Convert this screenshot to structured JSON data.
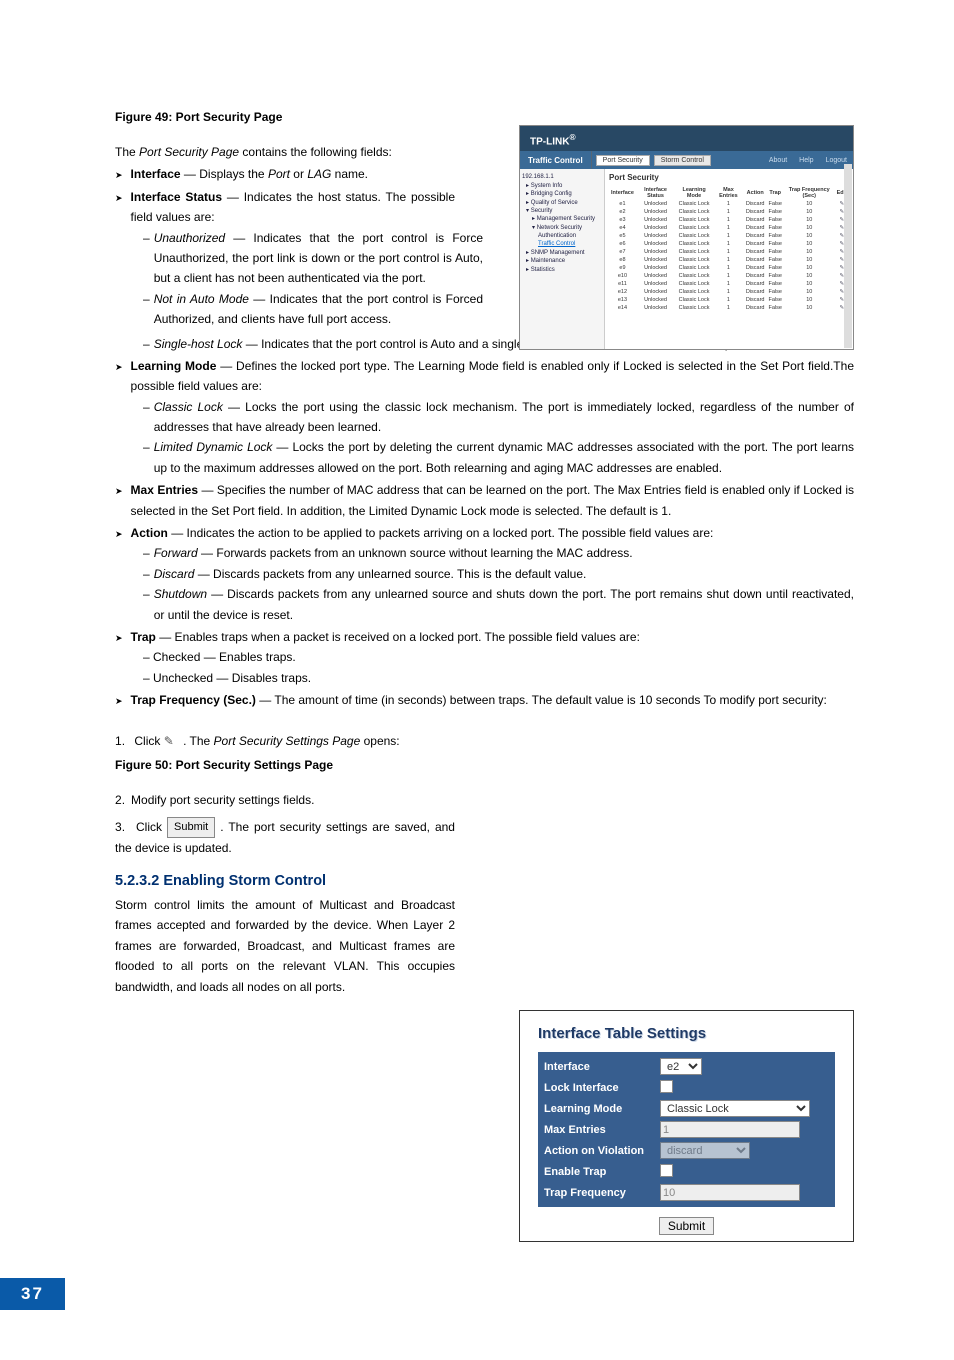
{
  "page_number": "37",
  "fig49_caption": "Figure 49: Port Security Page",
  "intro": "The Port Security Page contains the following fields:",
  "interface_label": "Interface",
  "interface_desc": " — Displays the Port or LAG name.",
  "interface_status_label": "Interface Status",
  "interface_status_desc": " — Indicates the host status. The possible field values are:",
  "unauthorized_label": "Unauthorized",
  "unauthorized_desc": " — Indicates that the port control is Force Unauthorized, the port link is down or the port control is Auto, but a client has not been authenticated via the port.",
  "notauto_label": "Not in Auto Mode",
  "notauto_desc": " — Indicates that the port control is Forced Authorized, and clients have full port access.",
  "singlehost_label": "Single-host Lock",
  "singlehost_desc": " — Indicates that the port control is Auto and a single client has been authenticated via the port.",
  "learning_label": "Learning Mode",
  "learning_desc": " — Defines the locked port type. The Learning Mode field is enabled only if Locked is selected in the Set Port field.The possible field values are:",
  "classic_label": "Classic Lock",
  "classic_desc": " — Locks the port using the classic lock mechanism. The port is immediately locked, regardless of the number of addresses that have already been learned.",
  "limited_label": "Limited Dynamic Lock",
  "limited_desc": " — Locks the port by deleting the current dynamic MAC addresses associated with the port. The port learns up to the maximum addresses allowed on the port. Both relearning and aging MAC addresses are enabled.",
  "maxentries_label": "Max Entries",
  "maxentries_desc": " — Specifies the number of MAC address that can be learned on the port. The Max Entries field is enabled only if Locked is selected in the Set Port field. In addition, the Limited Dynamic Lock mode is selected. The default is 1.",
  "action_label": "Action",
  "action_desc": " — Indicates the action to be applied to packets arriving on a locked port. The possible field values are:",
  "forward_label": "Forward",
  "forward_desc": " — Forwards packets from an unknown source without learning the MAC address.",
  "discard_label": "Discard",
  "discard_desc": " — Discards packets from any unlearned source. This is the default value.",
  "shutdown_label": "Shutdown",
  "shutdown_desc": " — Discards packets from any unlearned source and shuts down the port. The port remains shut down until reactivated, or until the device is reset.",
  "trap_label": "Trap",
  "trap_desc": " — Enables traps when a packet is received on a locked port. The possible field values are:",
  "checked_desc": "– Checked — Enables traps.",
  "unchecked_desc": "– Unchecked — Disables traps.",
  "trapfreq_label": "Trap Frequency (Sec.)",
  "trapfreq_desc": " — The amount of time (in seconds) between traps. The default value is 10 seconds To modify port security:",
  "step1_a": "Click ",
  "step1_b": " . The Port Security Settings Page opens:",
  "fig50_caption": "Figure 50: Port Security Settings Page",
  "step2": "Modify port security settings fields.",
  "step3_a": "Click ",
  "step3_b": ". The port security settings are saved, and the device is updated.",
  "submit_inline": "Submit",
  "section_heading": "5.2.3.2  Enabling Storm Control",
  "storm_text": "Storm control limits the amount of Multicast and Broadcast frames accepted and forwarded by the device. When Layer 2 frames are forwarded, Broadcast, and Multicast frames are flooded to all ports on the relevant VLAN. This occupies bandwidth, and loads all nodes on all ports.",
  "shot1": {
    "brand": "TP-LINK",
    "traffic_control": "Traffic Control",
    "tab_port_security": "Port Security",
    "tab_storm_control": "Storm Control",
    "about": "About",
    "help": "Help",
    "logout": "Logout",
    "title": "Port Security",
    "tree": {
      "root": "192.168.1.1",
      "system": "System Info",
      "bridging": "Bridging Config",
      "qos": "Quality of Service",
      "security": "Security",
      "mgmt": "Management Security",
      "netsec": "Network Security",
      "auth": "Authentication",
      "traffic": "Traffic Control",
      "snmp": "SNMP Management",
      "maint": "Maintenance",
      "stats": "Statistics"
    },
    "headers": [
      "Interface",
      "Interface Status",
      "Learning Mode",
      "Max Entries",
      "Action",
      "Trap",
      "Trap Frequency (Sec)",
      "Edit"
    ],
    "rows": [
      [
        "e1",
        "Unlocked",
        "Classic Lock",
        "1",
        "Discard",
        "False",
        "10"
      ],
      [
        "e2",
        "Unlocked",
        "Classic Lock",
        "1",
        "Discard",
        "False",
        "10"
      ],
      [
        "e3",
        "Unlocked",
        "Classic Lock",
        "1",
        "Discard",
        "False",
        "10"
      ],
      [
        "e4",
        "Unlocked",
        "Classic Lock",
        "1",
        "Discard",
        "False",
        "10"
      ],
      [
        "e5",
        "Unlocked",
        "Classic Lock",
        "1",
        "Discard",
        "False",
        "10"
      ],
      [
        "e6",
        "Unlocked",
        "Classic Lock",
        "1",
        "Discard",
        "False",
        "10"
      ],
      [
        "e7",
        "Unlocked",
        "Classic Lock",
        "1",
        "Discard",
        "False",
        "10"
      ],
      [
        "e8",
        "Unlocked",
        "Classic Lock",
        "1",
        "Discard",
        "False",
        "10"
      ],
      [
        "e9",
        "Unlocked",
        "Classic Lock",
        "1",
        "Discard",
        "False",
        "10"
      ],
      [
        "e10",
        "Unlocked",
        "Classic Lock",
        "1",
        "Discard",
        "False",
        "10"
      ],
      [
        "e11",
        "Unlocked",
        "Classic Lock",
        "1",
        "Discard",
        "False",
        "10"
      ],
      [
        "e12",
        "Unlocked",
        "Classic Lock",
        "1",
        "Discard",
        "False",
        "10"
      ],
      [
        "e13",
        "Unlocked",
        "Classic Lock",
        "1",
        "Discard",
        "False",
        "10"
      ],
      [
        "e14",
        "Unlocked",
        "Classic Lock",
        "1",
        "Discard",
        "False",
        "10"
      ]
    ]
  },
  "shot2": {
    "title": "Interface Table Settings",
    "interface_label": "Interface",
    "interface_value": "e2",
    "lock_label": "Lock Interface",
    "learning_label": "Learning Mode",
    "learning_value": "Classic Lock",
    "max_label": "Max Entries",
    "max_value": "1",
    "action_label": "Action on Violation",
    "action_value": "discard",
    "trap_label": "Enable Trap",
    "freq_label": "Trap Frequency",
    "freq_value": "10",
    "submit": "Submit"
  }
}
